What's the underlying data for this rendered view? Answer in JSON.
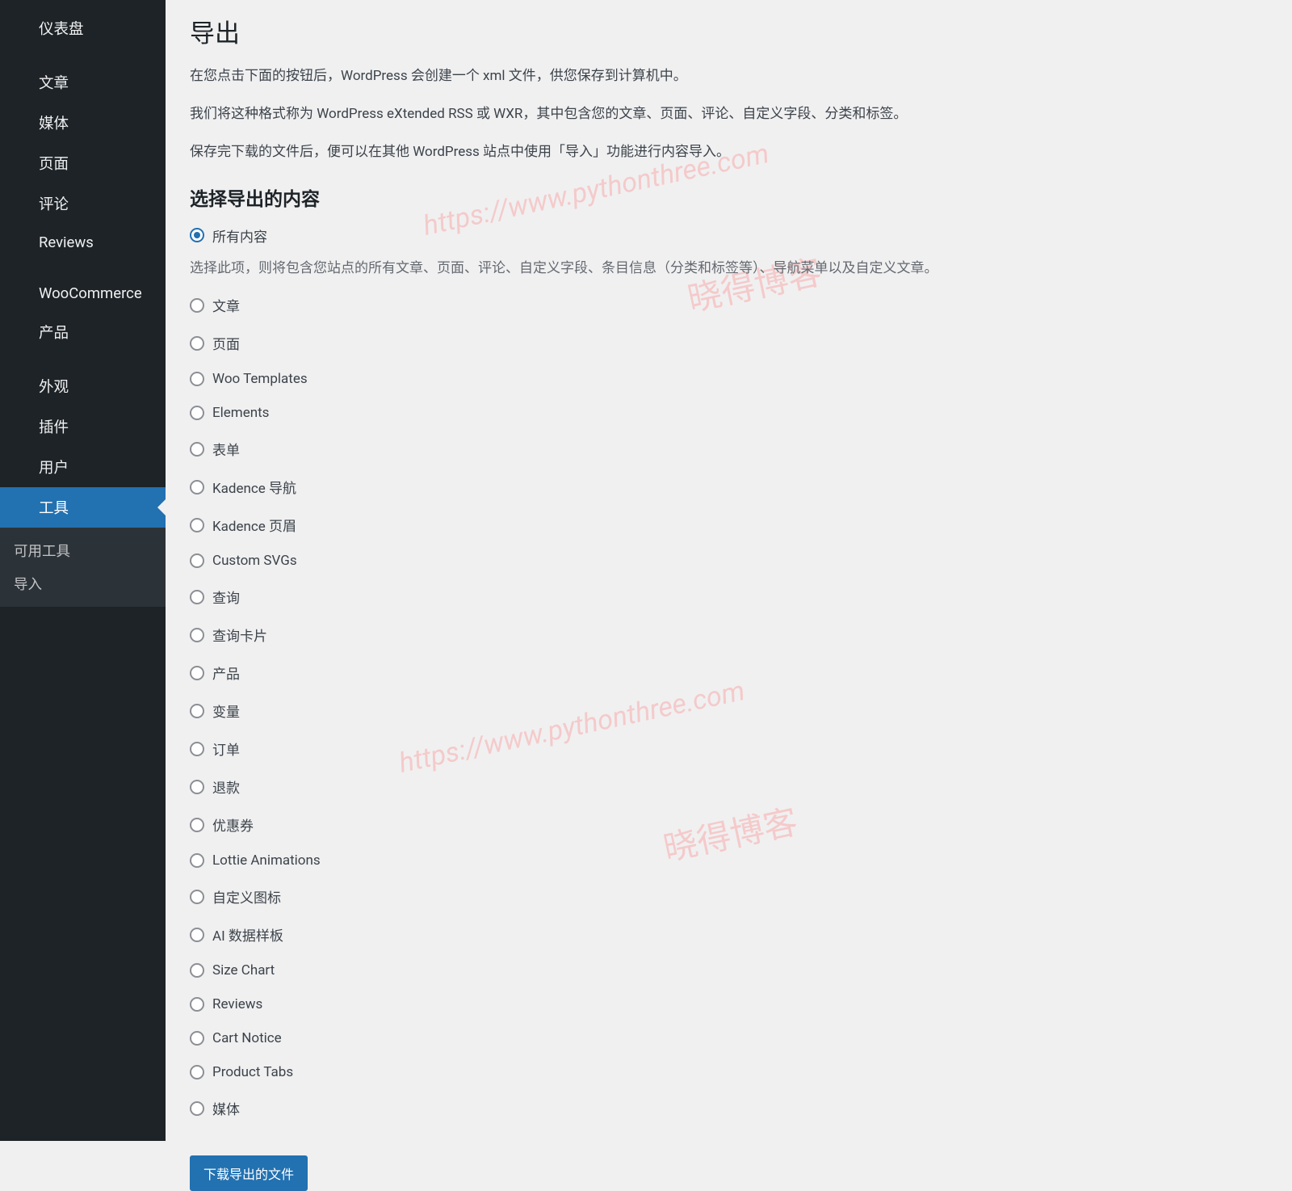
{
  "sidebar": {
    "items": [
      {
        "label": "仪表盘",
        "name": "sidebar-item-dashboard"
      },
      {
        "label": "文章",
        "name": "sidebar-item-posts"
      },
      {
        "label": "媒体",
        "name": "sidebar-item-media"
      },
      {
        "label": "页面",
        "name": "sidebar-item-pages"
      },
      {
        "label": "评论",
        "name": "sidebar-item-comments"
      },
      {
        "label": "Reviews",
        "name": "sidebar-item-reviews"
      },
      {
        "label": "WooCommerce",
        "name": "sidebar-item-woocommerce"
      },
      {
        "label": "产品",
        "name": "sidebar-item-products"
      },
      {
        "label": "外观",
        "name": "sidebar-item-appearance"
      },
      {
        "label": "插件",
        "name": "sidebar-item-plugins"
      },
      {
        "label": "用户",
        "name": "sidebar-item-users"
      },
      {
        "label": "工具",
        "name": "sidebar-item-tools",
        "active": true
      }
    ],
    "sub_items": [
      {
        "label": "可用工具",
        "name": "sidebar-sub-available-tools"
      },
      {
        "label": "导入",
        "name": "sidebar-sub-import"
      }
    ]
  },
  "page": {
    "title": "导出",
    "desc1": "在您点击下面的按钮后，WordPress 会创建一个 xml 文件，供您保存到计算机中。",
    "desc2": "我们将这种格式称为 WordPress eXtended RSS 或 WXR，其中包含您的文章、页面、评论、自定义字段、分类和标签。",
    "desc3": "保存完下载的文件后，便可以在其他 WordPress 站点中使用「导入」功能进行内容导入。",
    "section_title": "选择导出的内容",
    "all_content_note": "选择此项，则将包含您站点的所有文章、页面、评论、自定义字段、条目信息（分类和标签等）、导航菜单以及自定义文章。",
    "download_button": "下载导出的文件"
  },
  "options": [
    {
      "label": "所有内容",
      "checked": true,
      "name": "option-all-content"
    },
    {
      "label": "文章",
      "checked": false,
      "name": "option-posts"
    },
    {
      "label": "页面",
      "checked": false,
      "name": "option-pages"
    },
    {
      "label": "Woo Templates",
      "checked": false,
      "name": "option-woo-templates"
    },
    {
      "label": "Elements",
      "checked": false,
      "name": "option-elements"
    },
    {
      "label": "表单",
      "checked": false,
      "name": "option-forms"
    },
    {
      "label": "Kadence 导航",
      "checked": false,
      "name": "option-kadence-nav"
    },
    {
      "label": "Kadence 页眉",
      "checked": false,
      "name": "option-kadence-header"
    },
    {
      "label": "Custom SVGs",
      "checked": false,
      "name": "option-custom-svgs"
    },
    {
      "label": "查询",
      "checked": false,
      "name": "option-query"
    },
    {
      "label": "查询卡片",
      "checked": false,
      "name": "option-query-card"
    },
    {
      "label": "产品",
      "checked": false,
      "name": "option-products"
    },
    {
      "label": "变量",
      "checked": false,
      "name": "option-variations"
    },
    {
      "label": "订单",
      "checked": false,
      "name": "option-orders"
    },
    {
      "label": "退款",
      "checked": false,
      "name": "option-refunds"
    },
    {
      "label": "优惠券",
      "checked": false,
      "name": "option-coupons"
    },
    {
      "label": "Lottie Animations",
      "checked": false,
      "name": "option-lottie"
    },
    {
      "label": "自定义图标",
      "checked": false,
      "name": "option-custom-icons"
    },
    {
      "label": "AI 数据样板",
      "checked": false,
      "name": "option-ai-data"
    },
    {
      "label": "Size Chart",
      "checked": false,
      "name": "option-size-chart"
    },
    {
      "label": "Reviews",
      "checked": false,
      "name": "option-reviews"
    },
    {
      "label": "Cart Notice",
      "checked": false,
      "name": "option-cart-notice"
    },
    {
      "label": "Product Tabs",
      "checked": false,
      "name": "option-product-tabs"
    },
    {
      "label": "媒体",
      "checked": false,
      "name": "option-media"
    }
  ],
  "watermarks": {
    "url": "https://www.pythonthree.com",
    "cn": "晓得博客"
  }
}
